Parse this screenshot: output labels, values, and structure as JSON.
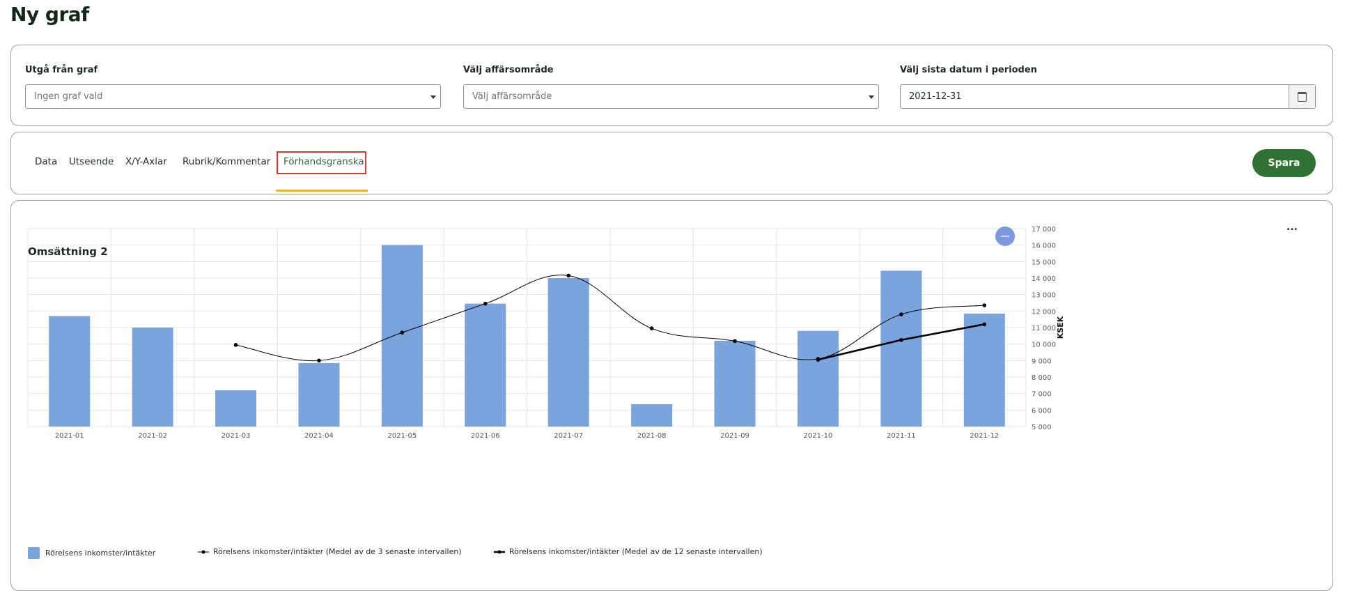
{
  "page": {
    "title": "Ny graf"
  },
  "filters": {
    "base_graph": {
      "label": "Utgå från graf",
      "placeholder": "Ingen graf vald"
    },
    "business_area": {
      "label": "Välj affärsområde",
      "placeholder": "Välj affärsområde"
    },
    "end_date": {
      "label": "Välj sista datum i perioden",
      "value": "2021-12-31"
    }
  },
  "tabs": {
    "items": [
      {
        "label": "Data"
      },
      {
        "label": "Utseende"
      },
      {
        "label": "X/Y-Axlar"
      },
      {
        "label": "Rubrik/Kommentar"
      },
      {
        "label": "Förhandsgranska",
        "active": true
      }
    ],
    "save_label": "Spara"
  },
  "chart_card": {
    "more_label": "..."
  },
  "chart_data": {
    "type": "bar",
    "title": "Omsättning 2",
    "ylabel": "KSEK",
    "xlabel": "",
    "ylim": [
      5000,
      17000
    ],
    "yticks": [
      "5 000",
      "6 000",
      "7 000",
      "8 000",
      "9 000",
      "10 000",
      "11 000",
      "12 000",
      "13 000",
      "14 000",
      "15 000",
      "16 000",
      "17 000"
    ],
    "categories": [
      "2021-01",
      "2021-02",
      "2021-03",
      "2021-04",
      "2021-05",
      "2021-06",
      "2021-07",
      "2021-08",
      "2021-09",
      "2021-10",
      "2021-11",
      "2021-12"
    ],
    "series": [
      {
        "name": "Rörelsens inkomster/intäkter",
        "type": "bar",
        "color": "#7ba4dd",
        "values": [
          11700,
          11000,
          7200,
          8850,
          16000,
          12450,
          14000,
          6350,
          10200,
          10800,
          14450,
          11850
        ]
      },
      {
        "name": "Rörelsens inkomster/intäkter (Medel av de 3 senaste intervallen)",
        "type": "line",
        "color": "#000000",
        "values": [
          null,
          null,
          9950,
          9000,
          10700,
          12450,
          14150,
          10950,
          10180,
          9100,
          11800,
          12350
        ]
      },
      {
        "name": "Rörelsens inkomster/intäkter (Medel av de 12 senaste intervallen)",
        "type": "line",
        "color": "#000000",
        "values": [
          null,
          null,
          null,
          null,
          null,
          null,
          null,
          null,
          null,
          9050,
          10250,
          11200
        ]
      }
    ],
    "grid": true,
    "legend": "bottom-left"
  }
}
